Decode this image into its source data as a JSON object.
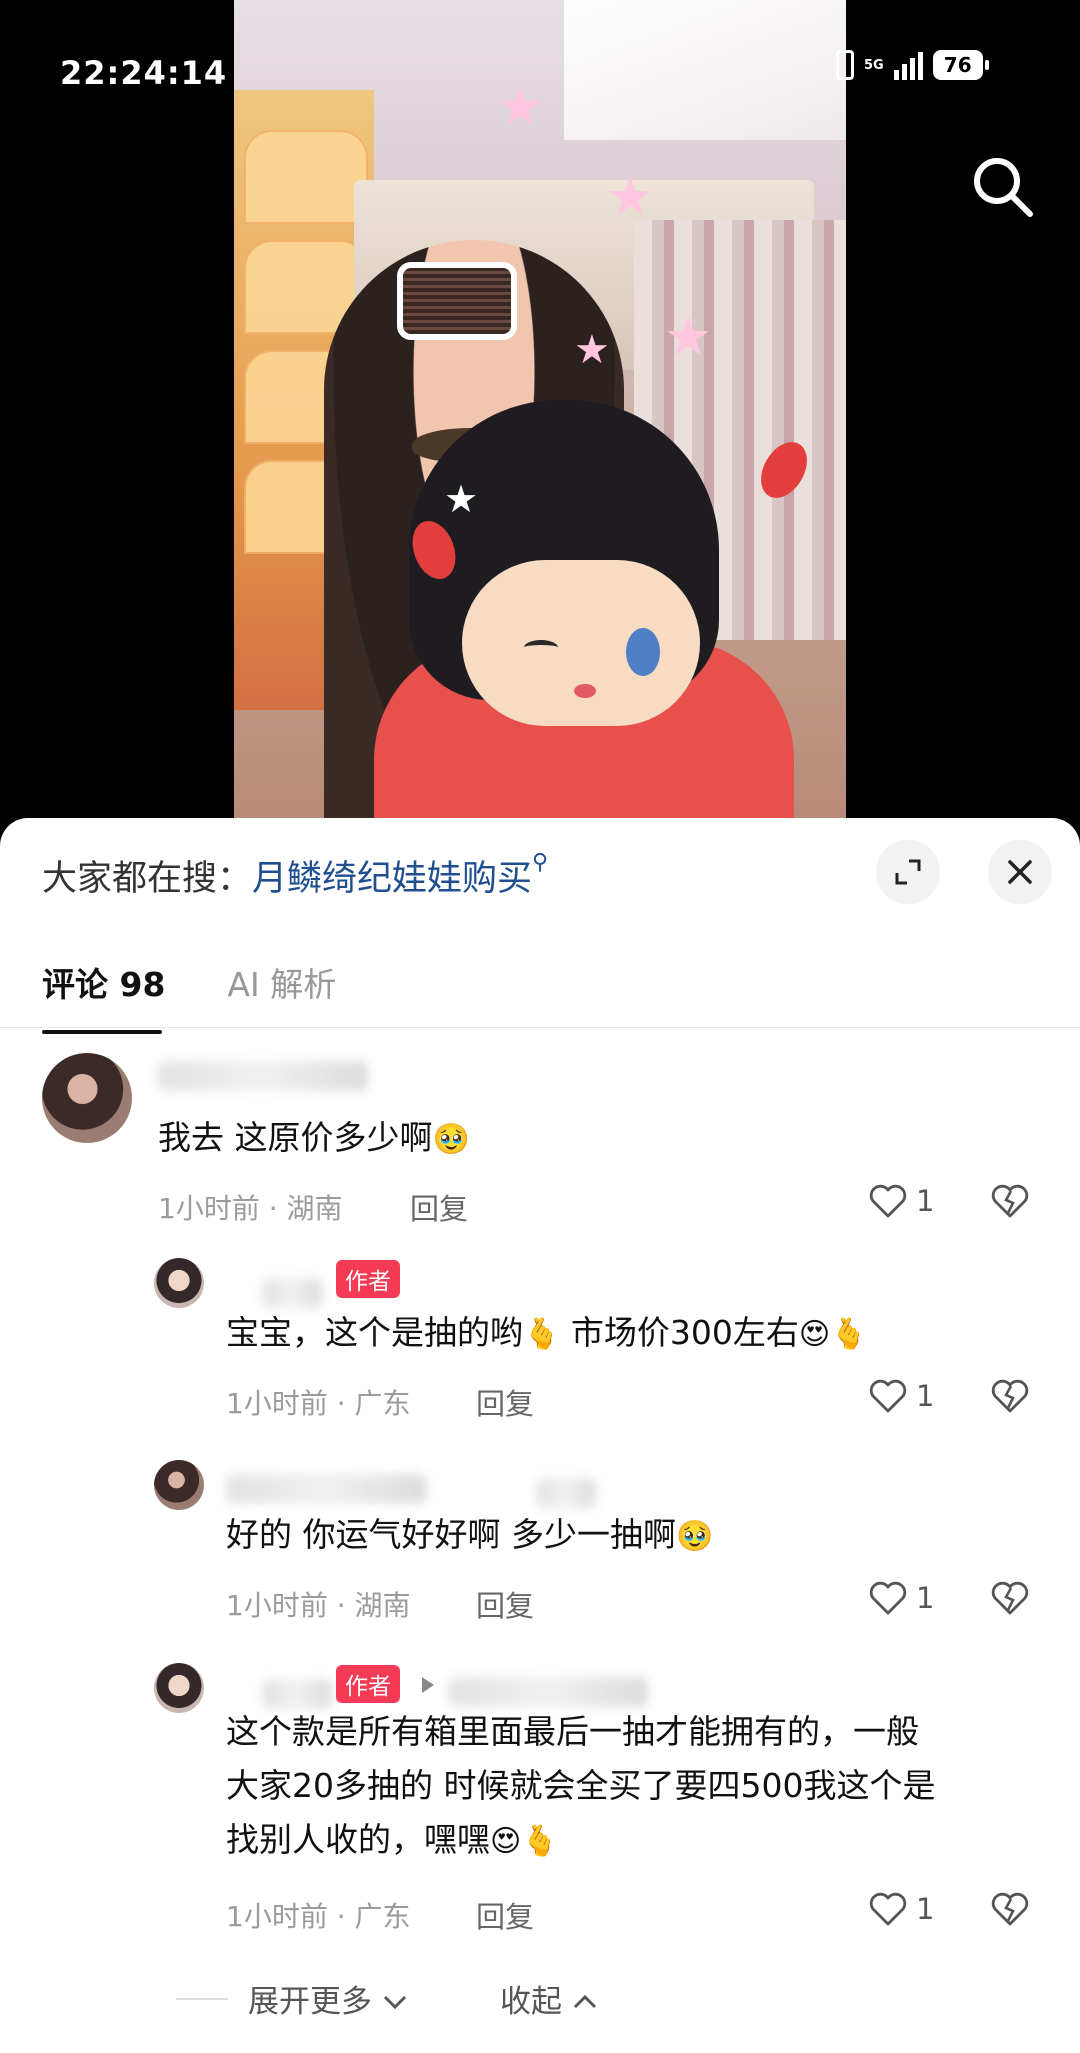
{
  "status_bar": {
    "time": "22:24:14",
    "network": "5G",
    "battery": "76"
  },
  "hot_search": {
    "prefix": "大家都在搜：",
    "query": "月鳞绮纪娃娃购买"
  },
  "tabs": [
    {
      "label": "评论 98",
      "active": true
    },
    {
      "label": "AI 解析",
      "active": false
    }
  ],
  "comments": [
    {
      "text": "我去 这原价多少啊",
      "emoji": "🥹",
      "time_location": "1小时前 · 湖南",
      "reply_label": "回复",
      "likes": "1"
    },
    {
      "author_tag": "作者",
      "text": "宝宝，这个是抽的哟",
      "emoji1": "🫰",
      "text2": " 市场价300左右",
      "emoji2": "😍",
      "emoji3": "🫰",
      "time_location": "1小时前 · 广东",
      "reply_label": "回复",
      "likes": "1"
    },
    {
      "text": "好的 你运气好好啊 多少一抽啊",
      "emoji": "🥹",
      "time_location": "1小时前 · 湖南",
      "reply_label": "回复",
      "likes": "1"
    },
    {
      "author_tag": "作者",
      "line1": "这个款是所有箱里面最后一抽才能拥有的，一般",
      "line2": "大家20多抽的 时候就会全买了要四500我这个是",
      "line3": "找别人收的，嘿嘿",
      "emoji1": "😍",
      "emoji2": "🫰",
      "time_location": "1小时前 · 广东",
      "reply_label": "回复",
      "likes": "1"
    }
  ],
  "footer": {
    "expand_label": "展开更多",
    "collapse_label": "收起"
  },
  "colors": {
    "link": "#1f4f8f",
    "author_tag": "#f53a55"
  }
}
